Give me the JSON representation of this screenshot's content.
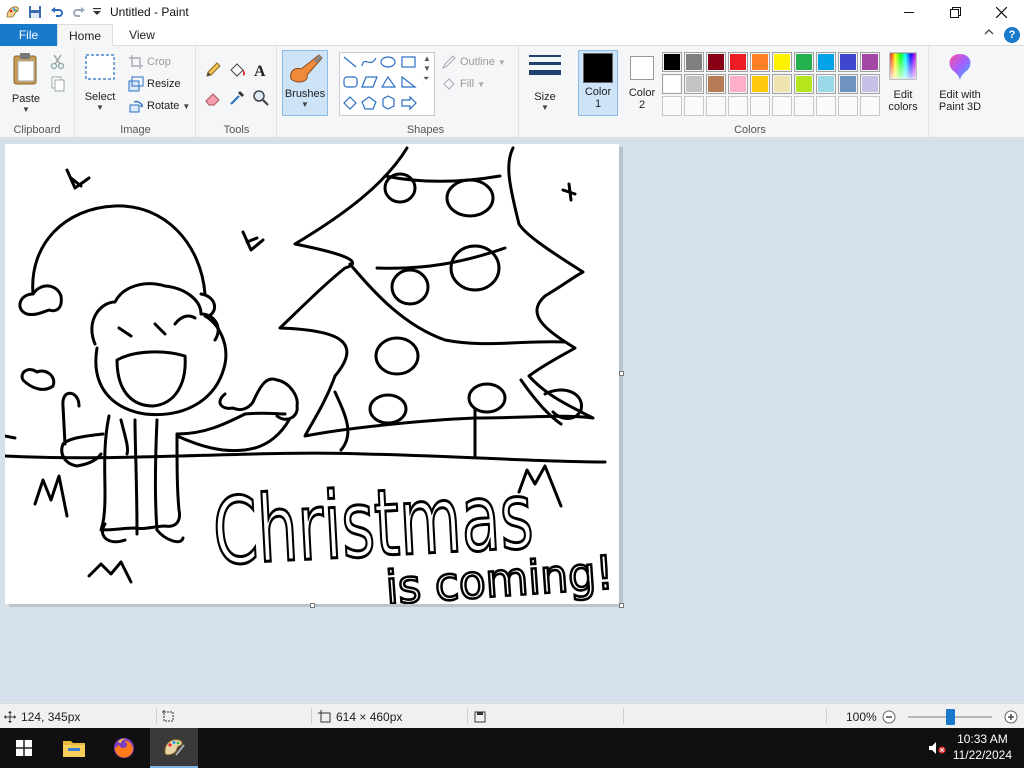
{
  "window": {
    "title": "Untitled - Paint"
  },
  "tabs": {
    "file": "File",
    "home": "Home",
    "view": "View"
  },
  "clipboard": {
    "paste": "Paste",
    "label": "Clipboard"
  },
  "image": {
    "select": "Select",
    "crop": "Crop",
    "resize": "Resize",
    "rotate": "Rotate",
    "label": "Image"
  },
  "tools": {
    "label": "Tools"
  },
  "brushes": {
    "label": "Brushes"
  },
  "shapes": {
    "outline": "Outline",
    "fill": "Fill",
    "label": "Shapes"
  },
  "size": {
    "label": "Size"
  },
  "colors": {
    "color1": "Color",
    "color1_num": "1",
    "color2": "Color",
    "color2_num": "2",
    "edit_colors_line1": "Edit",
    "edit_colors_line2": "colors",
    "paint3d_line1": "Edit with",
    "paint3d_line2": "Paint 3D",
    "label": "Colors",
    "color1_value": "#000000",
    "color2_value": "#ffffff",
    "palette_row1": [
      "#000000",
      "#7f7f7f",
      "#880015",
      "#ed1c24",
      "#ff7f27",
      "#fff200",
      "#22b14c",
      "#00a2e8",
      "#3f48cc",
      "#a349a4"
    ],
    "palette_row2": [
      "#ffffff",
      "#c3c3c3",
      "#b97a57",
      "#ffaec9",
      "#ffc90e",
      "#efe4b0",
      "#b5e61d",
      "#99d9ea",
      "#7092be",
      "#c8bfe7"
    ]
  },
  "drawing": {
    "text_line1": "Christmas",
    "text_line2": "is coming!"
  },
  "status": {
    "cursor_pos": "124, 345px",
    "canvas_size": "614 × 460px",
    "zoom": "100%"
  },
  "taskbar": {
    "time": "10:33 AM",
    "date": "11/22/2024"
  }
}
